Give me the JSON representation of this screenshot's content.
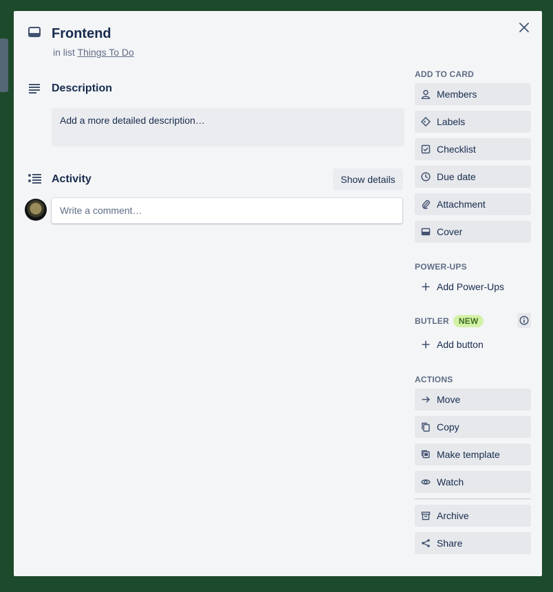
{
  "card": {
    "title": "Frontend",
    "in_list_prefix": "in list",
    "list_name": "Things To Do"
  },
  "description": {
    "heading": "Description",
    "placeholder": "Add a more detailed description…"
  },
  "activity": {
    "heading": "Activity",
    "show_details": "Show details",
    "comment_placeholder": "Write a comment…"
  },
  "sidebar": {
    "add_to_card": {
      "heading": "ADD TO CARD",
      "items": [
        {
          "label": "Members",
          "icon": "person-icon"
        },
        {
          "label": "Labels",
          "icon": "tag-icon"
        },
        {
          "label": "Checklist",
          "icon": "checkbox-icon"
        },
        {
          "label": "Due date",
          "icon": "clock-icon"
        },
        {
          "label": "Attachment",
          "icon": "paperclip-icon"
        },
        {
          "label": "Cover",
          "icon": "cover-icon"
        }
      ]
    },
    "power_ups": {
      "heading": "POWER-UPS",
      "add_label": "Add Power-Ups"
    },
    "butler": {
      "heading": "BUTLER",
      "badge": "NEW",
      "add_label": "Add button"
    },
    "actions": {
      "heading": "ACTIONS",
      "items": [
        {
          "label": "Move",
          "icon": "arrow-right-icon"
        },
        {
          "label": "Copy",
          "icon": "copy-icon"
        },
        {
          "label": "Make template",
          "icon": "template-icon"
        },
        {
          "label": "Watch",
          "icon": "eye-icon"
        },
        {
          "label": "Archive",
          "icon": "archive-icon"
        },
        {
          "label": "Share",
          "icon": "share-icon"
        }
      ]
    }
  },
  "colors": {
    "board_background": "#1d4a2a",
    "modal_background": "#f4f5f7",
    "button_background": "#e6e8ec",
    "badge_background": "#d3f1a7",
    "badge_text": "#3f6f21"
  }
}
